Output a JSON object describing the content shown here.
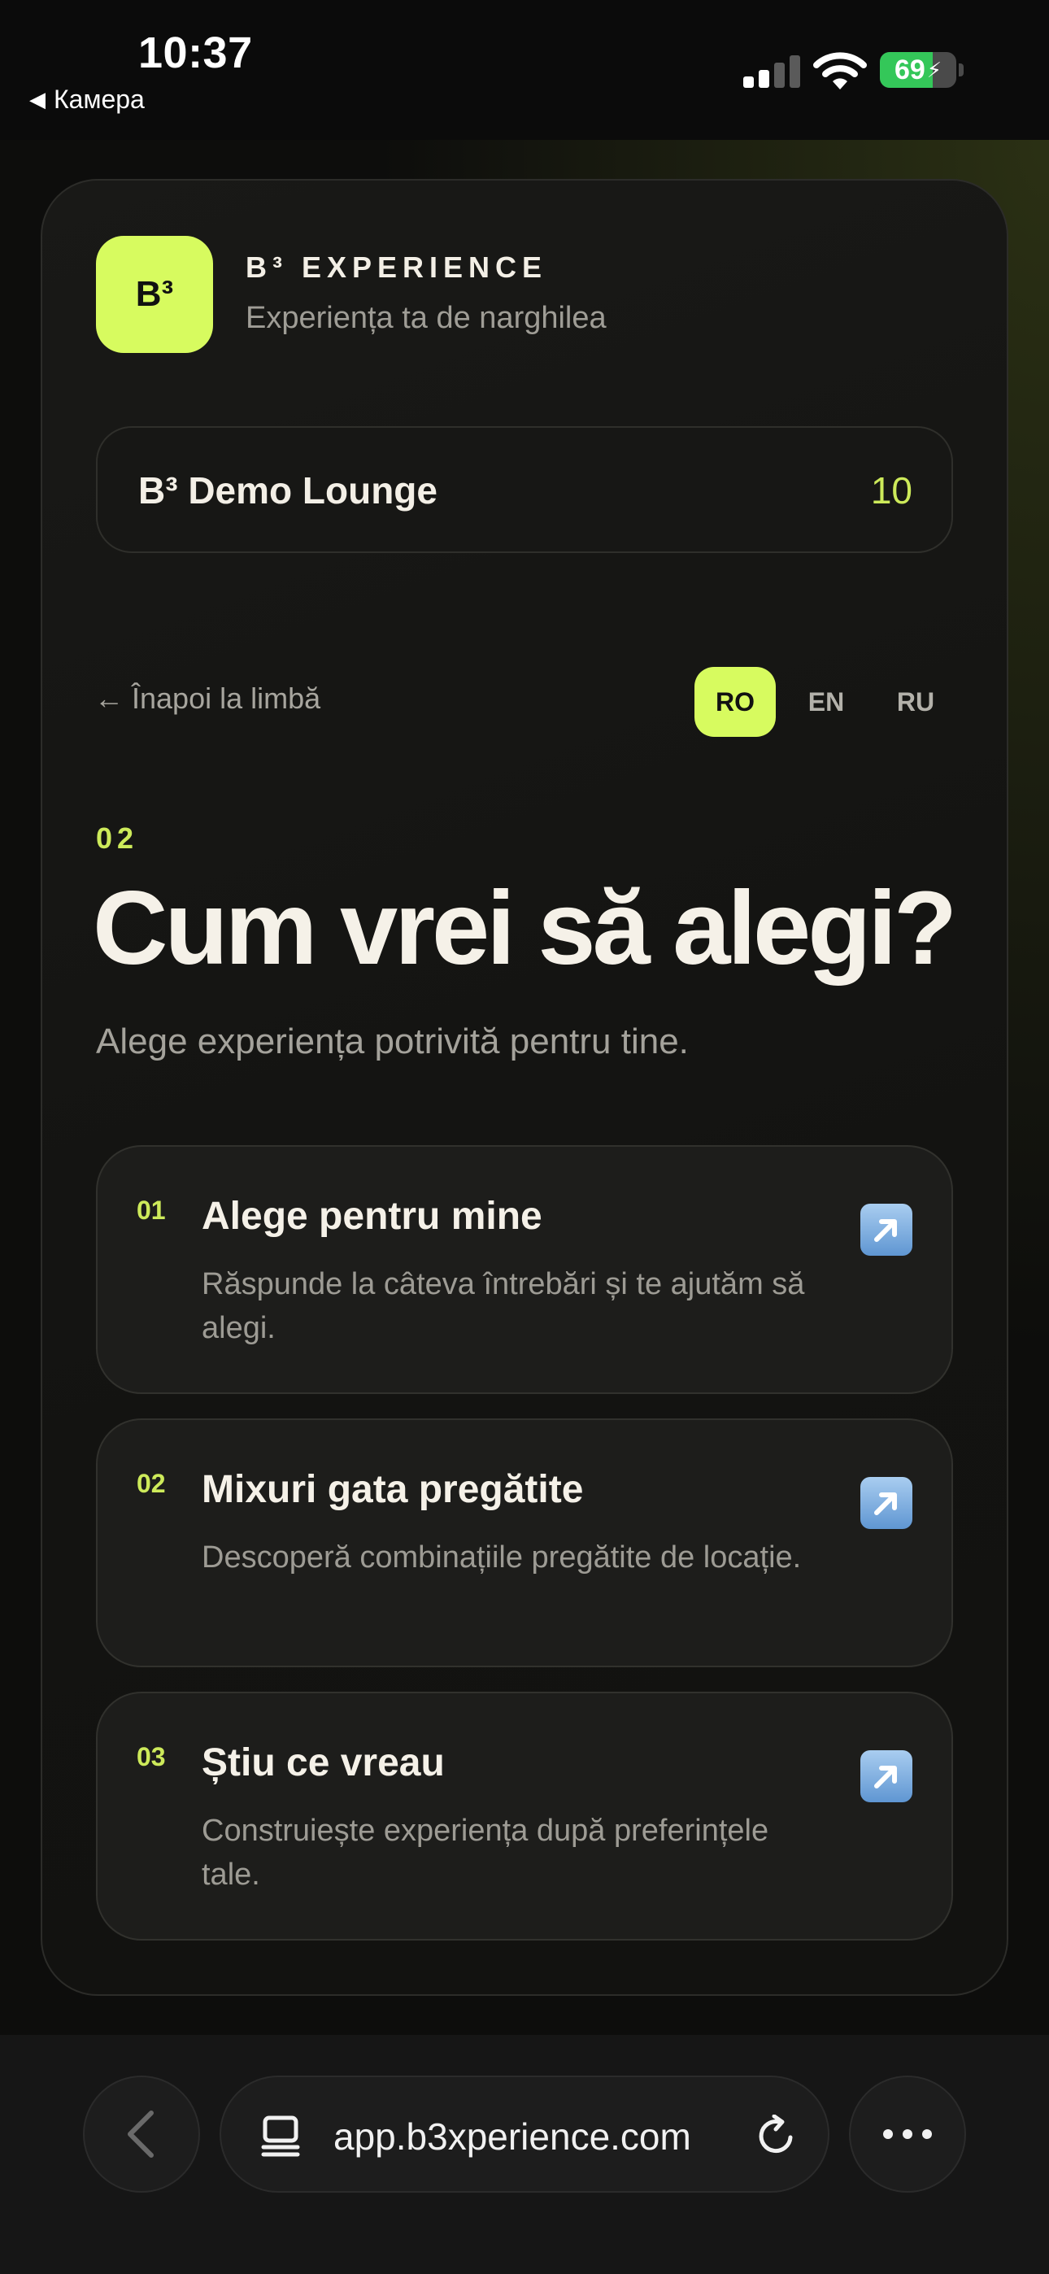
{
  "status_bar": {
    "time": "10:37",
    "back_app": "Камера",
    "battery": "69",
    "battery_level": 0.69
  },
  "brand": {
    "logo_text": "B³",
    "name": "B³ EXPERIENCE",
    "tagline": "Experiența ta de narghilea"
  },
  "venue": {
    "name": "B³ Demo Lounge",
    "number": "10"
  },
  "nav": {
    "back_label": "← Înapoi la limbă"
  },
  "languages": [
    {
      "code": "RO",
      "active": true
    },
    {
      "code": "EN",
      "active": false
    },
    {
      "code": "RU",
      "active": false
    }
  ],
  "step": {
    "number": "02",
    "title": "Cum vrei să alegi?",
    "subtitle": "Alege experiența potrivită pentru tine."
  },
  "options": [
    {
      "num": "01",
      "title": "Alege pentru mine",
      "desc": "Răspunde la câteva întrebări și te ajutăm să alegi.",
      "icon": "arrow-up-right-icon"
    },
    {
      "num": "02",
      "title": "Mixuri gata pregătite",
      "desc": "Descoperă combinațiile pregătite de locație.",
      "icon": "arrow-up-right-icon"
    },
    {
      "num": "03",
      "title": "Știu ce vreau",
      "desc": "Construiește experiența după preferințele tale.",
      "icon": "arrow-up-right-icon"
    }
  ],
  "browser": {
    "url": "app.b3xperience.com"
  },
  "colors": {
    "accent": "#d7fb5f",
    "accent_text": "#cdea5a",
    "background": "#0d0d0c",
    "card": "#1d1d1b"
  }
}
